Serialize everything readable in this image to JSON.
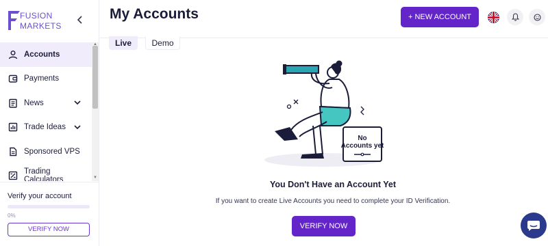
{
  "brand": {
    "line1": "FUSION",
    "line2": "MARKETS",
    "accent": "#6324c9"
  },
  "sidebar": {
    "items": [
      {
        "label": "Accounts",
        "icon": "user-icon",
        "active": true
      },
      {
        "label": "Payments",
        "icon": "wallet-icon"
      },
      {
        "label": "News",
        "icon": "newspaper-icon",
        "expandable": true
      },
      {
        "label": "Trade Ideas",
        "icon": "chart-icon",
        "expandable": true
      },
      {
        "label": "Sponsored VPS",
        "icon": "document-icon"
      },
      {
        "label": "Trading Calculators",
        "icon": "calculator-icon"
      }
    ],
    "verify": {
      "title": "Verify your account",
      "progress_percent": 0,
      "progress_label": "0%",
      "button_label": "VERIFY NOW"
    }
  },
  "header": {
    "title": "My Accounts",
    "new_account_label": "+ NEW ACCOUNT",
    "language_icon": "uk-flag-icon"
  },
  "tabs": [
    {
      "label": "Live",
      "selected": true
    },
    {
      "label": "Demo"
    }
  ],
  "illustration": {
    "sign_line1": "No",
    "sign_line2": "Accounts yet"
  },
  "empty_state": {
    "title": "You Don't Have an Account Yet",
    "description": "If you want to create Live Accounts you need to complete your ID Verification.",
    "button_label": "VERIFY NOW"
  }
}
